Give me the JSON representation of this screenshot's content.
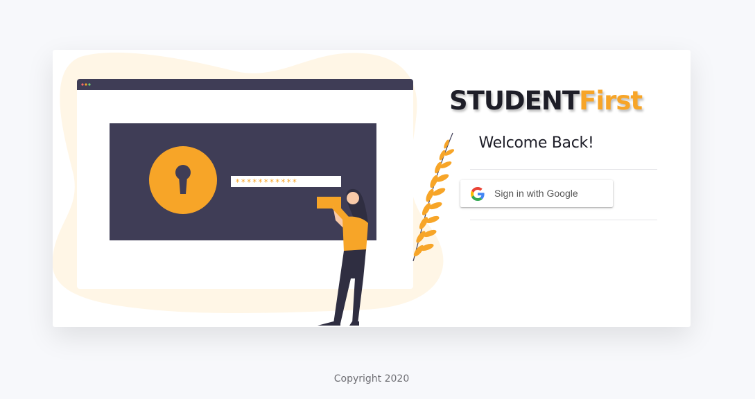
{
  "brand": {
    "part1": "STUDENT",
    "part2": "First"
  },
  "welcome": "Welcome Back!",
  "google_button": {
    "label": "Sign in with Google",
    "icon": "google-icon"
  },
  "illustration": {
    "password_mask": "***********",
    "icon": "keyhole-icon"
  },
  "footer": {
    "copyright": "Copyright 2020"
  },
  "colors": {
    "accent": "#f7a528",
    "dark": "#3f3d56",
    "background": "#f7f8fb",
    "blob": "#fff6e6"
  }
}
